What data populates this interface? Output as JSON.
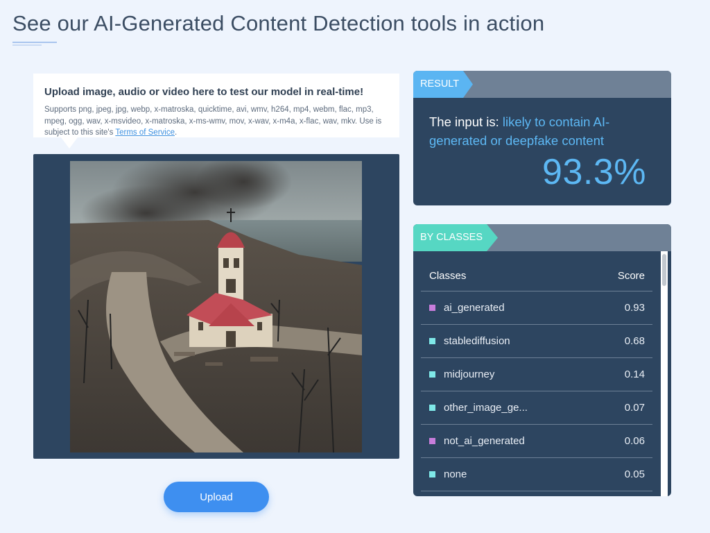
{
  "page": {
    "title": "See our AI-Generated Content Detection tools in action"
  },
  "upload_info": {
    "title": "Upload image, audio or video here to test our model in real-time!",
    "supports_text": "Supports png, jpeg, jpg, webp, x-matroska, quicktime, avi, wmv, h264, mp4, webm, flac, mp3, mpeg, ogg, wav, x-msvideo, x-matroska, x-ms-wmv, mov, x-wav, x-m4a, x-flac, wav, mkv. Use is subject to this site's ",
    "terms_link": "Terms of Service",
    "terms_suffix": "."
  },
  "preview_image": {
    "icon": "church-wildfire-photo"
  },
  "upload_button": {
    "label": "Upload"
  },
  "result": {
    "ribbon": "RESULT",
    "prefix": "The input is: ",
    "verdict": "likely to contain AI-generated or deepfake content",
    "percentage": "93.3%"
  },
  "classes": {
    "ribbon": "BY CLASSES",
    "col_class": "Classes",
    "col_score": "Score",
    "rows": [
      {
        "name": "ai_generated",
        "score": "0.93",
        "color": "#c77ddb"
      },
      {
        "name": "stablediffusion",
        "score": "0.68",
        "color": "#7fe8e8"
      },
      {
        "name": "midjourney",
        "score": "0.14",
        "color": "#7fe8e8"
      },
      {
        "name": "other_image_ge...",
        "score": "0.07",
        "color": "#7fe8e8"
      },
      {
        "name": "not_ai_generated",
        "score": "0.06",
        "color": "#c77ddb"
      },
      {
        "name": "none",
        "score": "0.05",
        "color": "#7fe8e8"
      }
    ]
  },
  "colors": {
    "accent_blue": "#5db8f4",
    "panel_navy": "#2d4560",
    "button_blue": "#3e8ff0",
    "ribbon_teal": "#56d7c3"
  }
}
